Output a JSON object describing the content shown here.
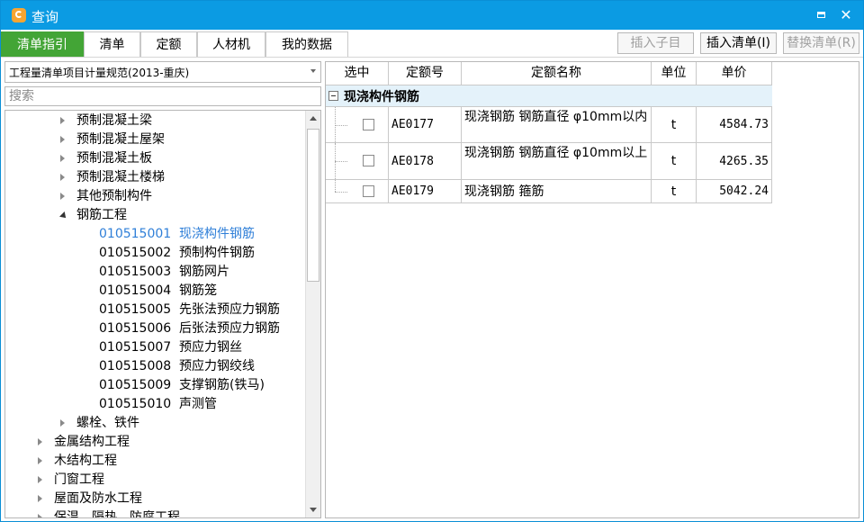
{
  "window": {
    "title": "查询",
    "close_glyph": "✕"
  },
  "tabs": [
    {
      "label": "清单指引",
      "active": true
    },
    {
      "label": "清单"
    },
    {
      "label": "定额"
    },
    {
      "label": "人材机"
    },
    {
      "label": "我的数据"
    }
  ],
  "actions": {
    "insert_child": "插入子目",
    "insert_list": "插入清单(I)",
    "replace_list": "替换清单(R)"
  },
  "spec_select": {
    "value": "工程量清单项目计量规范(2013-重庆)"
  },
  "search": {
    "placeholder": "搜索"
  },
  "tree": {
    "items": [
      {
        "name": "预制混凝土梁",
        "level": 2,
        "state": "collapsed"
      },
      {
        "name": "预制混凝土屋架",
        "level": 2,
        "state": "collapsed"
      },
      {
        "name": "预制混凝土板",
        "level": 2,
        "state": "collapsed"
      },
      {
        "name": "预制混凝土楼梯",
        "level": 2,
        "state": "collapsed"
      },
      {
        "name": "其他预制构件",
        "level": 2,
        "state": "collapsed"
      },
      {
        "name": "钢筋工程",
        "level": 2,
        "state": "expanded"
      },
      {
        "code": "010515001",
        "name": "现浇构件钢筋",
        "level": 3,
        "selected": true
      },
      {
        "code": "010515002",
        "name": "预制构件钢筋",
        "level": 3
      },
      {
        "code": "010515003",
        "name": "钢筋网片",
        "level": 3
      },
      {
        "code": "010515004",
        "name": "钢筋笼",
        "level": 3
      },
      {
        "code": "010515005",
        "name": "先张法预应力钢筋",
        "level": 3
      },
      {
        "code": "010515006",
        "name": "后张法预应力钢筋",
        "level": 3
      },
      {
        "code": "010515007",
        "name": "预应力钢丝",
        "level": 3
      },
      {
        "code": "010515008",
        "name": "预应力钢绞线",
        "level": 3
      },
      {
        "code": "010515009",
        "name": "支撑钢筋(铁马)",
        "level": 3
      },
      {
        "code": "010515010",
        "name": "声测管",
        "level": 3
      },
      {
        "name": "螺栓、铁件",
        "level": 2,
        "state": "collapsed"
      },
      {
        "name": "金属结构工程",
        "level": 1,
        "state": "collapsed"
      },
      {
        "name": "木结构工程",
        "level": 1,
        "state": "collapsed"
      },
      {
        "name": "门窗工程",
        "level": 1,
        "state": "collapsed"
      },
      {
        "name": "屋面及防水工程",
        "level": 1,
        "state": "collapsed"
      },
      {
        "name": "保温、隔热、防腐工程",
        "level": 1,
        "state": "collapsed"
      }
    ]
  },
  "grid": {
    "columns": [
      "选中",
      "定额号",
      "定额名称",
      "单位",
      "单价"
    ],
    "group": "现浇构件钢筋",
    "rows": [
      {
        "code": "AE0177",
        "name": "现浇钢筋 钢筋直径 φ10mm以内",
        "unit": "t",
        "price": "4584.73"
      },
      {
        "code": "AE0178",
        "name": "现浇钢筋 钢筋直径 φ10mm以上",
        "unit": "t",
        "price": "4265.35"
      },
      {
        "code": "AE0179",
        "name": "现浇钢筋 箍筋",
        "unit": "t",
        "price": "5042.24"
      }
    ]
  },
  "colors": {
    "title_bar": "#0b9be3",
    "active_tab": "#43a536",
    "selected_text": "#2f7fd8",
    "group_row": "#e4f2fa"
  }
}
